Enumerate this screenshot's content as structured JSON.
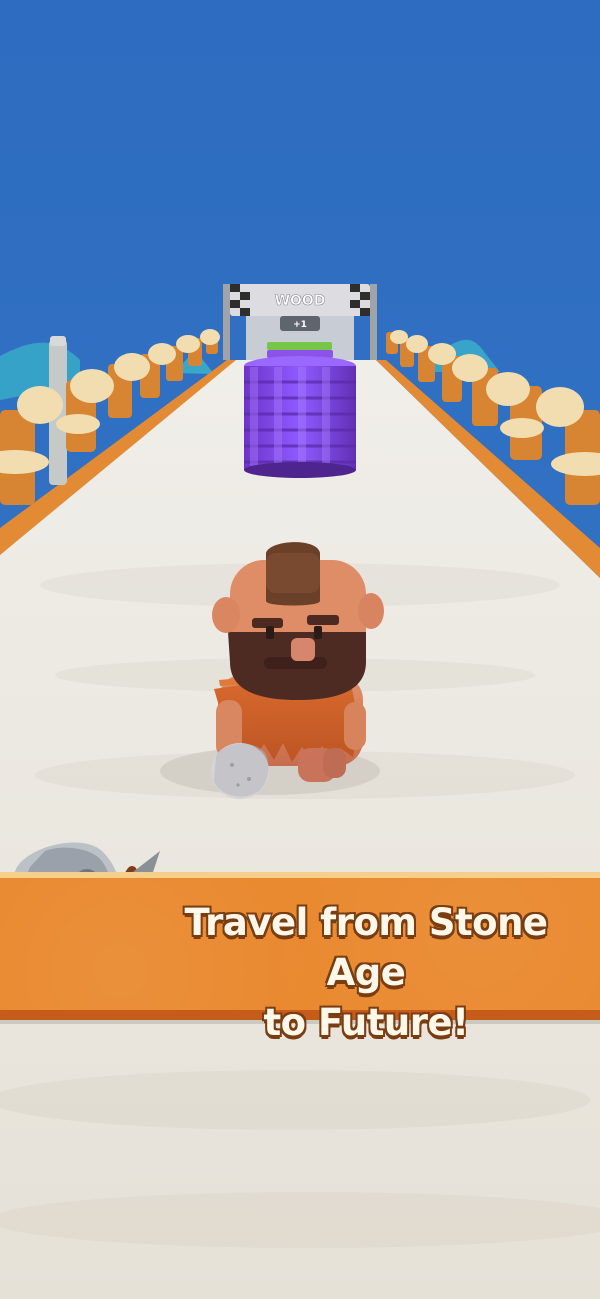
{
  "game": {
    "gate_label": "WOOD",
    "gate_counter": "+1",
    "tagline_line1": "Travel from Stone Age",
    "tagline_line2": "to Future!"
  },
  "colors": {
    "sky": "#2f6fbf",
    "road": "#ece9e2",
    "stack": "#7b45d8",
    "banner": "#e9892f",
    "banner_text": "#fff7e8"
  }
}
